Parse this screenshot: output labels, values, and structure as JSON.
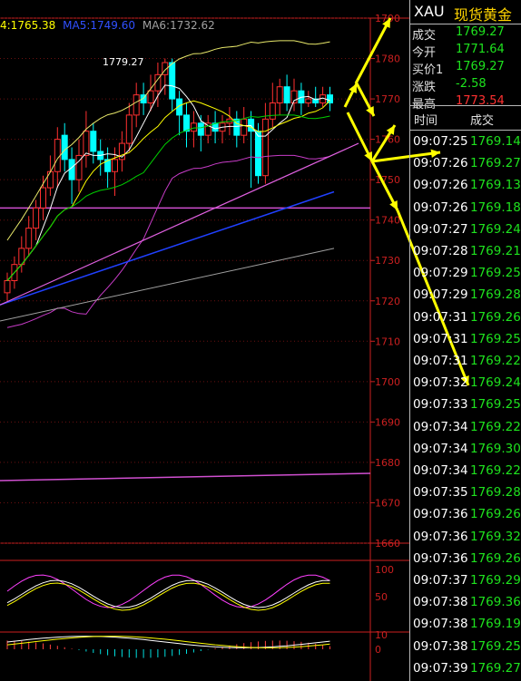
{
  "header": {
    "ma4": "4:1765.38",
    "ma5": "MA5:1749.60",
    "ma6": "MA6:1732.62"
  },
  "colors": {
    "up": "#ff3030",
    "down": "#00ffff",
    "axis": "#cc2020",
    "price_text": "#1ee21e",
    "arrow": "#ffff00"
  },
  "panel": {
    "symbol": "XAU",
    "name": "现货黄金",
    "quotes": [
      {
        "label": "成交",
        "value": "1769.27",
        "color": "#1ee21e"
      },
      {
        "label": "今开",
        "value": "1771.64",
        "color": "#1ee21e"
      },
      {
        "label": "买价1",
        "value": "1769.27",
        "color": "#1ee21e"
      },
      {
        "label": "涨跌",
        "value": "-2.58",
        "color": "#1ee21e"
      },
      {
        "label": "最高",
        "value": "1773.54",
        "color": "#ff3030"
      }
    ],
    "table_header": {
      "time": "时间",
      "price": "成交"
    },
    "ticks": [
      {
        "time": "09:07:25",
        "price": "1769.14"
      },
      {
        "time": "09:07:26",
        "price": "1769.27"
      },
      {
        "time": "09:07:26",
        "price": "1769.13"
      },
      {
        "time": "09:07:26",
        "price": "1769.18"
      },
      {
        "time": "09:07:27",
        "price": "1769.24"
      },
      {
        "time": "09:07:28",
        "price": "1769.21"
      },
      {
        "time": "09:07:29",
        "price": "1769.25"
      },
      {
        "time": "09:07:29",
        "price": "1769.28"
      },
      {
        "time": "09:07:31",
        "price": "1769.26"
      },
      {
        "time": "09:07:31",
        "price": "1769.25"
      },
      {
        "time": "09:07:31",
        "price": "1769.22"
      },
      {
        "time": "09:07:32",
        "price": "1769.24"
      },
      {
        "time": "09:07:33",
        "price": "1769.25"
      },
      {
        "time": "09:07:34",
        "price": "1769.22"
      },
      {
        "time": "09:07:34",
        "price": "1769.30"
      },
      {
        "time": "09:07:34",
        "price": "1769.22"
      },
      {
        "time": "09:07:35",
        "price": "1769.28"
      },
      {
        "time": "09:07:36",
        "price": "1769.26"
      },
      {
        "time": "09:07:36",
        "price": "1769.32"
      },
      {
        "time": "09:07:36",
        "price": "1769.26"
      },
      {
        "time": "09:07:37",
        "price": "1769.29"
      },
      {
        "time": "09:07:38",
        "price": "1769.36"
      },
      {
        "time": "09:07:38",
        "price": "1769.19"
      },
      {
        "time": "09:07:38",
        "price": "1769.25"
      },
      {
        "time": "09:07:39",
        "price": "1769.27"
      }
    ]
  },
  "chart_data": {
    "type": "candlestick",
    "price_axis": {
      "min": 1660,
      "max": 1790,
      "ticks": [
        1790,
        1780,
        1770,
        1760,
        1750,
        1740,
        1730,
        1720,
        1710,
        1700,
        1690,
        1680,
        1670,
        1660
      ]
    },
    "annotation": "1779.27",
    "candles": [
      {
        "o": 1722,
        "c": 1725,
        "h": 1727,
        "l": 1720
      },
      {
        "o": 1725,
        "c": 1729,
        "h": 1731,
        "l": 1723
      },
      {
        "o": 1729,
        "c": 1733,
        "h": 1736,
        "l": 1727
      },
      {
        "o": 1733,
        "c": 1738,
        "h": 1741,
        "l": 1731
      },
      {
        "o": 1738,
        "c": 1743,
        "h": 1745,
        "l": 1735
      },
      {
        "o": 1743,
        "c": 1748,
        "h": 1751,
        "l": 1740
      },
      {
        "o": 1748,
        "c": 1752,
        "h": 1756,
        "l": 1746
      },
      {
        "o": 1752,
        "c": 1760,
        "h": 1763,
        "l": 1748
      },
      {
        "o": 1761,
        "c": 1755,
        "h": 1764,
        "l": 1752
      },
      {
        "o": 1755,
        "c": 1750,
        "h": 1758,
        "l": 1744
      },
      {
        "o": 1750,
        "c": 1756,
        "h": 1760,
        "l": 1747
      },
      {
        "o": 1756,
        "c": 1762,
        "h": 1767,
        "l": 1753
      },
      {
        "o": 1762,
        "c": 1757,
        "h": 1764,
        "l": 1754
      },
      {
        "o": 1757,
        "c": 1755,
        "h": 1760,
        "l": 1751
      },
      {
        "o": 1755,
        "c": 1752,
        "h": 1758,
        "l": 1748
      },
      {
        "o": 1752,
        "c": 1755,
        "h": 1758,
        "l": 1746
      },
      {
        "o": 1755,
        "c": 1759,
        "h": 1762,
        "l": 1752
      },
      {
        "o": 1759,
        "c": 1766,
        "h": 1769,
        "l": 1757
      },
      {
        "o": 1766,
        "c": 1771,
        "h": 1774,
        "l": 1763
      },
      {
        "o": 1771,
        "c": 1769,
        "h": 1774,
        "l": 1766
      },
      {
        "o": 1769,
        "c": 1772,
        "h": 1776,
        "l": 1767
      },
      {
        "o": 1772,
        "c": 1776,
        "h": 1779,
        "l": 1768
      },
      {
        "o": 1776,
        "c": 1779,
        "h": 1780,
        "l": 1771
      },
      {
        "o": 1779,
        "c": 1770,
        "h": 1780,
        "l": 1767
      },
      {
        "o": 1770,
        "c": 1766,
        "h": 1772,
        "l": 1761
      },
      {
        "o": 1766,
        "c": 1762,
        "h": 1769,
        "l": 1758
      },
      {
        "o": 1762,
        "c": 1764,
        "h": 1767,
        "l": 1758
      },
      {
        "o": 1764,
        "c": 1761,
        "h": 1766,
        "l": 1757
      },
      {
        "o": 1761,
        "c": 1764,
        "h": 1766,
        "l": 1759
      },
      {
        "o": 1764,
        "c": 1762,
        "h": 1767,
        "l": 1759
      },
      {
        "o": 1762,
        "c": 1764,
        "h": 1766,
        "l": 1759
      },
      {
        "o": 1764,
        "c": 1765,
        "h": 1768,
        "l": 1761
      },
      {
        "o": 1765,
        "c": 1761,
        "h": 1767,
        "l": 1758
      },
      {
        "o": 1761,
        "c": 1765,
        "h": 1768,
        "l": 1759
      },
      {
        "o": 1765,
        "c": 1762,
        "h": 1767,
        "l": 1748
      },
      {
        "o": 1762,
        "c": 1751,
        "h": 1764,
        "l": 1749
      },
      {
        "o": 1751,
        "c": 1765,
        "h": 1769,
        "l": 1749
      },
      {
        "o": 1765,
        "c": 1769,
        "h": 1774,
        "l": 1763
      },
      {
        "o": 1769,
        "c": 1773,
        "h": 1775,
        "l": 1766
      },
      {
        "o": 1773,
        "c": 1769,
        "h": 1776,
        "l": 1767
      },
      {
        "o": 1769,
        "c": 1772,
        "h": 1775,
        "l": 1767
      },
      {
        "o": 1772,
        "c": 1769,
        "h": 1774,
        "l": 1766
      },
      {
        "o": 1769,
        "c": 1770,
        "h": 1772,
        "l": 1768
      },
      {
        "o": 1770,
        "c": 1769,
        "h": 1773,
        "l": 1768
      },
      {
        "o": 1769,
        "c": 1771,
        "h": 1773,
        "l": 1768
      },
      {
        "o": 1771,
        "c": 1769,
        "h": 1773,
        "l": 1767
      }
    ],
    "horizontal_lines": [
      {
        "value": 1743,
        "color": "#d04fd0"
      },
      {
        "value": 1677,
        "color": "#d04fd0",
        "end_value": 1678
      }
    ],
    "indicator1_axis": [
      100,
      50
    ],
    "indicator2_axis": [
      10,
      0
    ]
  }
}
